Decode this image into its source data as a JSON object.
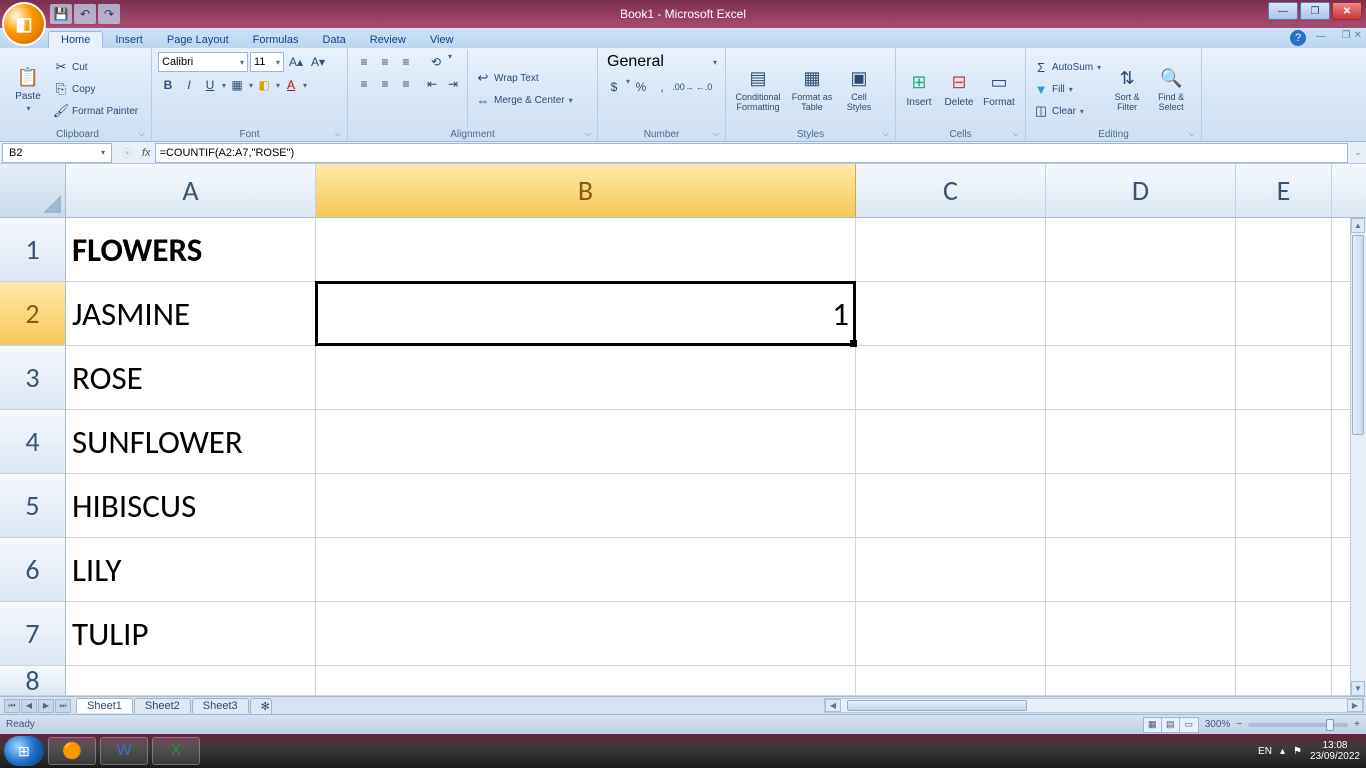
{
  "window": {
    "title": "Book1 - Microsoft Excel",
    "qat": {
      "save": "💾",
      "undo": "↶",
      "redo": "↷"
    }
  },
  "tabs": {
    "items": [
      "Home",
      "Insert",
      "Page Layout",
      "Formulas",
      "Data",
      "Review",
      "View"
    ],
    "active": "Home"
  },
  "ribbon": {
    "clipboard": {
      "label": "Clipboard",
      "paste": "Paste",
      "cut": "Cut",
      "copy": "Copy",
      "format_painter": "Format Painter"
    },
    "font": {
      "label": "Font",
      "name": "Calibri",
      "size": "11",
      "bold": "B",
      "italic": "I",
      "underline": "U"
    },
    "alignment": {
      "label": "Alignment",
      "wrap_text": "Wrap Text",
      "merge_center": "Merge & Center"
    },
    "number": {
      "label": "Number",
      "format": "General"
    },
    "styles": {
      "label": "Styles",
      "conditional": "Conditional Formatting",
      "format_table": "Format as Table",
      "cell_styles": "Cell Styles"
    },
    "cells": {
      "label": "Cells",
      "insert": "Insert",
      "delete": "Delete",
      "format": "Format"
    },
    "editing": {
      "label": "Editing",
      "autosum": "AutoSum",
      "fill": "Fill",
      "clear": "Clear",
      "sort_filter": "Sort & Filter",
      "find_select": "Find & Select"
    }
  },
  "formula_bar": {
    "name_box": "B2",
    "formula": "=COUNTIF(A2:A7,\"ROSE\")"
  },
  "sheet": {
    "columns": [
      "A",
      "B",
      "C",
      "D",
      "E"
    ],
    "rows": [
      "1",
      "2",
      "3",
      "4",
      "5",
      "6",
      "7",
      "8"
    ],
    "selected_cell": "B2",
    "cells": {
      "A1": "FLOWERS",
      "A2": "JASMINE",
      "A3": "ROSE",
      "A4": "SUNFLOWER",
      "A5": "HIBISCUS",
      "A6": "LILY",
      "A7": "TULIP",
      "B2": "1"
    }
  },
  "sheet_tabs": {
    "items": [
      "Sheet1",
      "Sheet2",
      "Sheet3"
    ],
    "active": "Sheet1"
  },
  "statusbar": {
    "mode": "Ready",
    "zoom": "300%"
  },
  "taskbar": {
    "lang": "EN",
    "time": "13:08",
    "date": "23/09/2022"
  }
}
